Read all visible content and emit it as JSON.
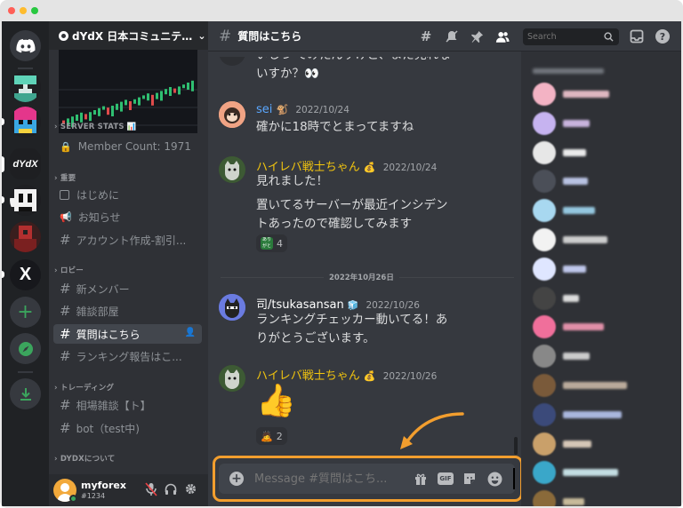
{
  "window": {
    "traffic_lights": [
      "#ff5f57",
      "#febc2e",
      "#28c840"
    ]
  },
  "rail": {
    "servers": [
      {
        "name": "discord-home-icon"
      },
      {
        "name": "server-pixel-1"
      },
      {
        "name": "server-pixel-2"
      },
      {
        "name": "dydx",
        "label": "dYdX"
      },
      {
        "name": "server-pixel-3"
      },
      {
        "name": "server-pixel-4"
      },
      {
        "name": "server-x",
        "label": "X"
      }
    ]
  },
  "server": {
    "name": "dYdX 日本コミュニテ…"
  },
  "sidebar": {
    "categories": [
      {
        "label": "SERVER STATS 📊"
      },
      {
        "label": "重要"
      },
      {
        "label": "ロビー"
      },
      {
        "label": "トレーディング"
      },
      {
        "label": "DYDXについて"
      }
    ],
    "channels": [
      {
        "label": "Member Count: 1971"
      },
      {
        "label": "はじめに"
      },
      {
        "label": "お知らせ"
      },
      {
        "label": "アカウント作成-割引..."
      },
      {
        "label": "新メンバー"
      },
      {
        "label": "雑談部屋"
      },
      {
        "label": "質問はこちら"
      },
      {
        "label": "ランキング報告はこ..."
      },
      {
        "label": "相場雑談【ト】"
      },
      {
        "label": "bot（test中)"
      }
    ]
  },
  "user": {
    "name": "myforex",
    "tag": "#1234"
  },
  "chat": {
    "channel_name": "質問はこちら",
    "search_placeholder": "Search",
    "messages": [
      {
        "text_lines": [
          "いしつ てみたんすけど、まだ見れな",
          "いすか？👀"
        ]
      },
      {
        "author": "sei",
        "author_emoji": "🐒",
        "timestamp": "2022/10/24",
        "text_lines": [
          "確かに18時でとまってますね"
        ]
      },
      {
        "author": "ハイレバ戦士ちゃん",
        "author_emoji": "💰",
        "timestamp": "2022/10/24",
        "text_lines": [
          "見れました！",
          "置いてるサーバーが最近インシデン",
          "トあったので確認してみます"
        ],
        "reaction": {
          "emoji": "ありがとう",
          "count": "4"
        }
      },
      {
        "author": "司/tsukasansan",
        "author_emoji": "🧊",
        "timestamp": "2022/10/26",
        "text_lines": [
          "ランキングチェッカー動いてる！あ",
          "りがとうございます。"
        ]
      },
      {
        "author": "ハイレバ戦士ちゃん",
        "author_emoji": "💰",
        "timestamp": "2022/10/26",
        "text_lines": [
          "👍"
        ],
        "reaction": {
          "emoji": "🙇",
          "count": "2"
        }
      }
    ],
    "date_divider": "2022年10月26日",
    "composer": {
      "placeholder": "Message #質問はこち...",
      "gif_label": "GIF"
    }
  },
  "colors": {
    "accent_orange": "#f29e2e",
    "author_yellow": "#f1c40f",
    "author_blue": "#5aa7ff",
    "author_white": "#ffffff"
  }
}
